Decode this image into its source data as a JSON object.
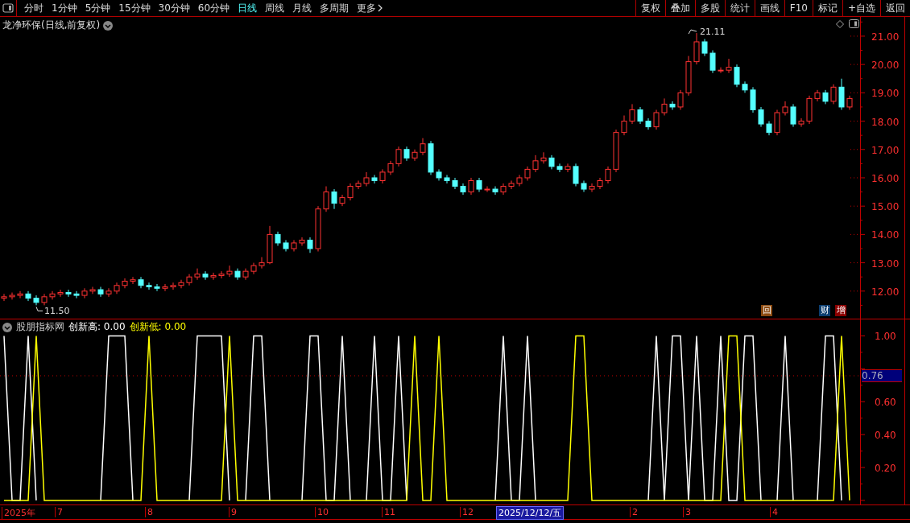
{
  "toolbar": {
    "periods": [
      {
        "label": "分时",
        "selected": false
      },
      {
        "label": "1分钟",
        "selected": false
      },
      {
        "label": "5分钟",
        "selected": false
      },
      {
        "label": "15分钟",
        "selected": false
      },
      {
        "label": "30分钟",
        "selected": false
      },
      {
        "label": "60分钟",
        "selected": false
      },
      {
        "label": "日线",
        "selected": true
      },
      {
        "label": "周线",
        "selected": false
      },
      {
        "label": "月线",
        "selected": false
      },
      {
        "label": "多周期",
        "selected": false
      },
      {
        "label": "更多",
        "selected": false
      }
    ],
    "buttons": [
      "复权",
      "叠加",
      "多股",
      "统计",
      "画线",
      "F10",
      "标记",
      "+自选",
      "返回"
    ]
  },
  "main_chart": {
    "title": "龙净环保(日线,前复权)",
    "high_label": "21.11",
    "low_label": "11.50",
    "badges": [
      {
        "text": "回",
        "color": "#8b4a10"
      },
      {
        "text": "财",
        "color": "#0b3d6e"
      },
      {
        "text": "增",
        "color": "#8b0000"
      }
    ],
    "chart_data": {
      "type": "candlestick",
      "ylim": [
        11.0,
        21.68
      ],
      "yticks": [
        {
          "value": 21,
          "label": "21.00"
        },
        {
          "value": 20,
          "label": "20.00"
        },
        {
          "value": 19,
          "label": "19.00"
        },
        {
          "value": 18,
          "label": "18.00"
        },
        {
          "value": 17,
          "label": "17.00"
        },
        {
          "value": 16,
          "label": "16.00"
        },
        {
          "value": 15,
          "label": "15.00"
        },
        {
          "value": 14,
          "label": "14.00"
        },
        {
          "value": 13,
          "label": "13.00"
        },
        {
          "value": 12,
          "label": "12.00"
        }
      ],
      "ohlc": [
        [
          11.75,
          11.9,
          11.65,
          11.8
        ],
        [
          11.8,
          11.95,
          11.7,
          11.85
        ],
        [
          11.85,
          12.0,
          11.75,
          11.9
        ],
        [
          11.9,
          12.0,
          11.65,
          11.75
        ],
        [
          11.75,
          11.85,
          11.5,
          11.6
        ],
        [
          11.6,
          11.9,
          11.5,
          11.8
        ],
        [
          11.8,
          12.0,
          11.7,
          11.9
        ],
        [
          11.9,
          12.05,
          11.8,
          11.95
        ],
        [
          11.95,
          12.05,
          11.8,
          11.9
        ],
        [
          11.9,
          12.0,
          11.75,
          11.85
        ],
        [
          11.85,
          12.1,
          11.75,
          12.0
        ],
        [
          12.0,
          12.15,
          11.9,
          12.05
        ],
        [
          12.05,
          12.15,
          11.8,
          11.9
        ],
        [
          11.9,
          12.1,
          11.8,
          12.0
        ],
        [
          12.0,
          12.3,
          11.9,
          12.2
        ],
        [
          12.2,
          12.45,
          12.1,
          12.35
        ],
        [
          12.35,
          12.5,
          12.25,
          12.4
        ],
        [
          12.4,
          12.5,
          12.1,
          12.2
        ],
        [
          12.2,
          12.3,
          12.05,
          12.15
        ],
        [
          12.15,
          12.25,
          12.0,
          12.1
        ],
        [
          12.1,
          12.25,
          12.0,
          12.15
        ],
        [
          12.15,
          12.3,
          12.05,
          12.2
        ],
        [
          12.2,
          12.4,
          12.1,
          12.3
        ],
        [
          12.3,
          12.6,
          12.2,
          12.5
        ],
        [
          12.5,
          12.8,
          12.4,
          12.6
        ],
        [
          12.6,
          12.7,
          12.4,
          12.5
        ],
        [
          12.5,
          12.65,
          12.4,
          12.55
        ],
        [
          12.55,
          12.7,
          12.45,
          12.6
        ],
        [
          12.6,
          12.9,
          12.5,
          12.7
        ],
        [
          12.7,
          12.8,
          12.4,
          12.5
        ],
        [
          12.5,
          12.8,
          12.4,
          12.7
        ],
        [
          12.7,
          13.0,
          12.6,
          12.9
        ],
        [
          12.9,
          13.2,
          12.8,
          13.0
        ],
        [
          13.0,
          14.3,
          12.95,
          14.0
        ],
        [
          14.0,
          14.1,
          13.6,
          13.7
        ],
        [
          13.7,
          13.8,
          13.4,
          13.5
        ],
        [
          13.5,
          13.8,
          13.4,
          13.7
        ],
        [
          13.7,
          13.9,
          13.6,
          13.8
        ],
        [
          13.8,
          13.9,
          13.35,
          13.5
        ],
        [
          13.5,
          15.0,
          13.4,
          14.9
        ],
        [
          14.9,
          15.7,
          14.8,
          15.5
        ],
        [
          15.5,
          15.6,
          14.9,
          15.1
        ],
        [
          15.1,
          15.4,
          15.0,
          15.3
        ],
        [
          15.3,
          15.8,
          15.2,
          15.7
        ],
        [
          15.7,
          15.9,
          15.6,
          15.8
        ],
        [
          15.8,
          16.2,
          15.7,
          16.0
        ],
        [
          16.0,
          16.1,
          15.8,
          15.9
        ],
        [
          15.9,
          16.3,
          15.8,
          16.2
        ],
        [
          16.2,
          16.6,
          16.1,
          16.5
        ],
        [
          16.5,
          17.1,
          16.4,
          17.0
        ],
        [
          17.0,
          17.1,
          16.6,
          16.7
        ],
        [
          16.7,
          17.0,
          16.6,
          16.9
        ],
        [
          16.9,
          17.4,
          16.8,
          17.2
        ],
        [
          17.2,
          17.3,
          16.1,
          16.2
        ],
        [
          16.2,
          16.3,
          15.9,
          16.0
        ],
        [
          16.0,
          16.1,
          15.8,
          15.9
        ],
        [
          15.9,
          16.0,
          15.6,
          15.7
        ],
        [
          15.7,
          15.8,
          15.4,
          15.5
        ],
        [
          15.5,
          16.0,
          15.4,
          15.9
        ],
        [
          15.9,
          16.0,
          15.5,
          15.6
        ],
        [
          15.6,
          15.7,
          15.5,
          15.6
        ],
        [
          15.6,
          15.7,
          15.4,
          15.5
        ],
        [
          15.5,
          15.8,
          15.4,
          15.7
        ],
        [
          15.7,
          15.9,
          15.6,
          15.8
        ],
        [
          15.8,
          16.1,
          15.7,
          16.0
        ],
        [
          16.0,
          16.4,
          15.9,
          16.3
        ],
        [
          16.3,
          16.8,
          16.2,
          16.6
        ],
        [
          16.6,
          16.9,
          16.5,
          16.7
        ],
        [
          16.7,
          16.8,
          16.3,
          16.4
        ],
        [
          16.4,
          16.5,
          16.2,
          16.3
        ],
        [
          16.3,
          16.5,
          16.2,
          16.4
        ],
        [
          16.4,
          16.5,
          15.7,
          15.8
        ],
        [
          15.8,
          15.9,
          15.5,
          15.6
        ],
        [
          15.6,
          15.8,
          15.5,
          15.7
        ],
        [
          15.7,
          16.0,
          15.6,
          15.9
        ],
        [
          15.9,
          16.4,
          15.8,
          16.3
        ],
        [
          16.3,
          17.7,
          16.2,
          17.6
        ],
        [
          17.6,
          18.2,
          17.5,
          18.0
        ],
        [
          18.0,
          18.6,
          17.9,
          18.4
        ],
        [
          18.4,
          18.5,
          17.9,
          18.0
        ],
        [
          18.0,
          18.1,
          17.7,
          17.8
        ],
        [
          17.8,
          18.4,
          17.7,
          18.3
        ],
        [
          18.3,
          18.8,
          18.2,
          18.6
        ],
        [
          18.6,
          18.7,
          18.4,
          18.5
        ],
        [
          18.5,
          19.1,
          18.4,
          19.0
        ],
        [
          19.0,
          20.3,
          18.9,
          20.1
        ],
        [
          20.1,
          21.11,
          20.0,
          20.8
        ],
        [
          20.8,
          20.9,
          20.3,
          20.4
        ],
        [
          20.4,
          20.5,
          19.7,
          19.8
        ],
        [
          19.8,
          19.9,
          19.7,
          19.8
        ],
        [
          19.8,
          20.2,
          19.7,
          19.9
        ],
        [
          19.9,
          20.0,
          19.2,
          19.3
        ],
        [
          19.3,
          19.4,
          19.0,
          19.1
        ],
        [
          19.1,
          19.2,
          18.3,
          18.4
        ],
        [
          18.4,
          18.5,
          17.8,
          17.9
        ],
        [
          17.9,
          18.0,
          17.5,
          17.6
        ],
        [
          17.6,
          18.4,
          17.5,
          18.3
        ],
        [
          18.3,
          18.7,
          18.2,
          18.5
        ],
        [
          18.5,
          18.6,
          17.8,
          17.9
        ],
        [
          17.9,
          18.1,
          17.8,
          18.0
        ],
        [
          18.0,
          18.9,
          17.9,
          18.8
        ],
        [
          18.8,
          19.1,
          18.7,
          19.0
        ],
        [
          19.0,
          19.1,
          18.6,
          18.7
        ],
        [
          18.7,
          19.3,
          18.6,
          19.2
        ],
        [
          19.2,
          19.5,
          18.4,
          18.5
        ],
        [
          18.5,
          18.9,
          18.4,
          18.8
        ]
      ]
    }
  },
  "indicator": {
    "name": "股朋指标网",
    "cursor_value": "0.76",
    "chart_data": {
      "type": "line",
      "ylim": [
        -0.02,
        1.1
      ],
      "yticks": [
        {
          "value": 1,
          "label": "1.00"
        },
        {
          "value": 0.6,
          "label": "0.60"
        },
        {
          "value": 0.4,
          "label": "0.40"
        },
        {
          "value": 0.2,
          "label": "0.20"
        }
      ],
      "series": [
        {
          "name": "创新高: 0.00",
          "color": "#ffffff",
          "values": [
            1,
            0,
            0,
            1,
            0,
            null,
            null,
            null,
            null,
            null,
            null,
            null,
            0,
            1,
            1,
            1,
            0,
            null,
            null,
            null,
            null,
            null,
            null,
            0,
            1,
            1,
            1,
            1,
            0,
            null,
            0,
            1,
            1,
            0,
            null,
            null,
            null,
            0,
            1,
            1,
            0,
            0,
            1,
            0,
            null,
            0,
            1,
            0,
            0,
            1,
            0,
            null,
            null,
            null,
            null,
            null,
            null,
            null,
            null,
            null,
            null,
            0,
            1,
            0,
            0,
            1,
            0,
            null,
            null,
            null,
            null,
            null,
            null,
            null,
            null,
            null,
            null,
            null,
            null,
            null,
            0,
            1,
            0,
            1,
            1,
            0,
            1,
            0,
            0,
            1,
            0,
            0,
            1,
            1,
            0,
            null,
            0,
            1,
            0,
            null,
            null,
            0,
            1,
            1,
            0,
            null
          ]
        },
        {
          "name": "创新低: 0.00",
          "color": "#ffff00",
          "values": [
            0,
            0,
            0,
            0,
            1,
            0,
            0,
            0,
            0,
            0,
            0,
            0,
            0,
            0,
            0,
            0,
            0,
            0,
            1,
            0,
            0,
            0,
            0,
            0,
            0,
            0,
            0,
            0,
            1,
            0,
            0,
            0,
            0,
            0,
            0,
            0,
            0,
            0,
            0,
            0,
            0,
            0,
            0,
            0,
            0,
            0,
            0,
            0,
            0,
            0,
            0,
            1,
            0,
            0,
            1,
            0,
            0,
            0,
            0,
            0,
            0,
            0,
            0,
            0,
            0,
            0,
            0,
            0,
            0,
            0,
            0,
            1,
            1,
            0,
            0,
            0,
            0,
            0,
            0,
            0,
            0,
            0,
            0,
            0,
            0,
            0,
            0,
            0,
            0,
            0,
            1,
            1,
            0,
            0,
            0,
            0,
            0,
            0,
            0,
            0,
            0,
            0,
            0,
            0,
            1,
            0
          ]
        }
      ]
    }
  },
  "date_axis": {
    "labels": [
      "2025年",
      "7",
      "8",
      "9",
      "10",
      "11",
      "12",
      "2",
      "3",
      "4"
    ],
    "cursor_date": "2025/12/12/五"
  }
}
